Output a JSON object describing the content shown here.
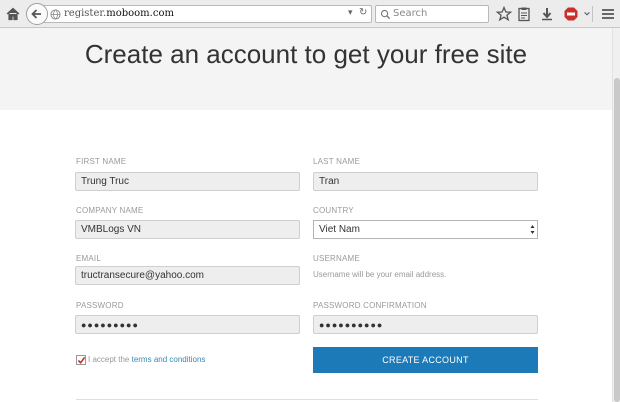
{
  "browser": {
    "url_prefix": "register.",
    "url_domain": "moboom.com",
    "url_dropdown": "▾",
    "url_reload": "↻",
    "search_placeholder": "Search"
  },
  "page": {
    "title": "Create an account to get your free site"
  },
  "form": {
    "first_name": {
      "label": "FIRST NAME",
      "value": "Trung Truc"
    },
    "last_name": {
      "label": "LAST NAME",
      "value": "Tran"
    },
    "company_name": {
      "label": "COMPANY NAME",
      "value": "VMBLogs VN"
    },
    "country": {
      "label": "COUNTRY",
      "value": "Viet Nam"
    },
    "email": {
      "label": "EMAIL",
      "value": "tructransecure@yahoo.com"
    },
    "username": {
      "label": "USERNAME",
      "hint": "Username will be your email address."
    },
    "password": {
      "label": "PASSWORD",
      "value": "●●●●●●●●●"
    },
    "password_confirmation": {
      "label": "PASSWORD CONFIRMATION",
      "value": "●●●●●●●●●●"
    },
    "accept_prefix": "I accept the",
    "terms_link": "terms and conditions",
    "accept_checked": true,
    "create_button": "CREATE ACCOUNT"
  },
  "colors": {
    "button": "#1c7ab8",
    "link": "#3a87b5",
    "banner": "#f4f4f4",
    "checkmark": "#c0392b"
  },
  "icons": [
    "home-icon",
    "back-arrow-icon",
    "globe-icon",
    "search-icon",
    "star-icon",
    "clipboard-icon",
    "download-icon",
    "adblock-icon",
    "more-icon",
    "menu-icon"
  ]
}
